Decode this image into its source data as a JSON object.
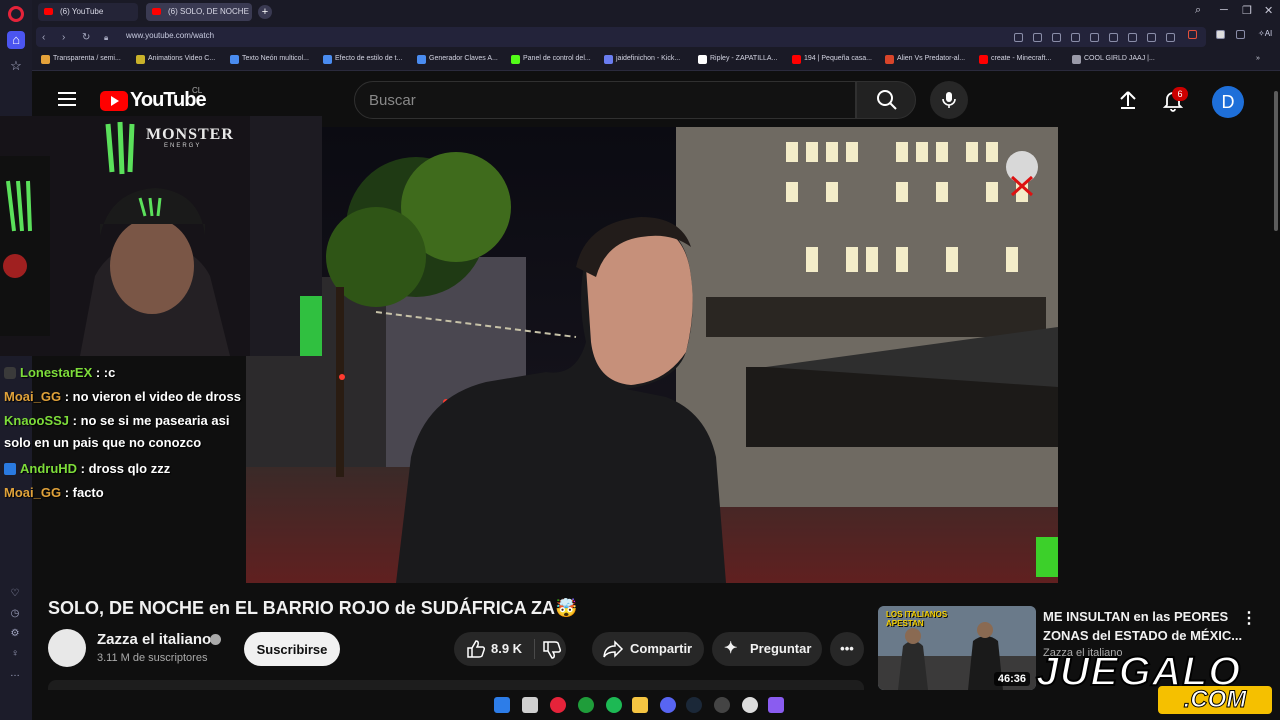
{
  "browser": {
    "tabs": [
      {
        "label": "(6) YouTube"
      },
      {
        "label": "(6) SOLO, DE NOCHE"
      }
    ],
    "url": "www.youtube.com/watch",
    "bookmarks": [
      {
        "label": "Transparenta / semi...",
        "color": "#e5a23a"
      },
      {
        "label": "Animations Video C...",
        "color": "#c9b22a"
      },
      {
        "label": "Texto Neón multicol...",
        "color": "#4a8cf0"
      },
      {
        "label": "Efecto de estilo de t...",
        "color": "#4a8cf0"
      },
      {
        "label": "Generador Claves A...",
        "color": "#4a8cf0"
      },
      {
        "label": "Panel de control del...",
        "color": "#53fc18"
      },
      {
        "label": "jaidefinichon - Kick...",
        "color": "#6a7df0"
      },
      {
        "label": "Ripley - ZAPATILLA...",
        "color": "#ffffff"
      },
      {
        "label": "194 | Pequeña casa...",
        "color": "#ff0000"
      },
      {
        "label": "Alien Vs Predator-al...",
        "color": "#d9452a"
      },
      {
        "label": "create - Minecraft...",
        "color": "#ff0000"
      },
      {
        "label": "COOL GIRLD JAAJ |...",
        "color": "#9a9aa8"
      }
    ]
  },
  "yt": {
    "logo_text": "YouTube",
    "country": "CL",
    "search_placeholder": "Buscar",
    "notif_count": "6",
    "avatar_letter": "D"
  },
  "overlay": {
    "brand": "MONSTER",
    "brand_sub": "ENERGY",
    "chat": [
      {
        "user": "LonestarEX",
        "message": " : :c",
        "color": "#7ddc3a"
      },
      {
        "user": "Moai_GG",
        "message": " : no vieron el video de dross",
        "color": "#e0a23a"
      },
      {
        "user": "KnaooSSJ",
        "message": " : no se si me pasearia asi solo en un pais que no conozco",
        "color": "#7ddc3a"
      },
      {
        "user": "AndruHD",
        "message": " : dross qlo zzz",
        "color": "#7ddc3a"
      },
      {
        "user": "Moai_GG",
        "message": " : facto",
        "color": "#e0a23a"
      }
    ]
  },
  "video": {
    "title": "SOLO, DE NOCHE en EL BARRIO ROJO de SUDÁFRICA ZA🤯",
    "channel": "Zazza el italiano",
    "subscribers": "3.11 M de suscriptores",
    "subscribe_label": "Suscribirse",
    "likes": "8.9 K",
    "share_label": "Compartir",
    "ask_label": "Preguntar"
  },
  "recommendation": {
    "title": "ME INSULTAN en las PEORES ZONAS del ESTADO de MÉXIC...",
    "channel": "Zazza el italiano",
    "duration": "46:36",
    "thumb_text": "LOS ITALIANOS APESTAN"
  },
  "watermark": {
    "text": "JUEGALO",
    "com": ".COM"
  }
}
